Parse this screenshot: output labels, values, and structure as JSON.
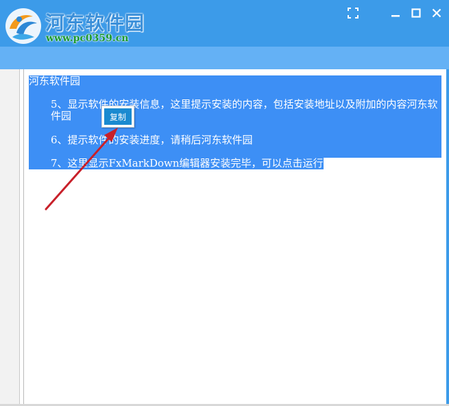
{
  "header": {
    "logo_title": "河东软件园",
    "logo_url": "www.pc0359.cn",
    "icons": [
      "logo-icon",
      "fullscreen-icon",
      "minimize-icon",
      "maximize-icon",
      "close-icon"
    ]
  },
  "content": {
    "title": "河东软件园",
    "line5": "5、显示软件的安装信息，这里提示安装的内容，包括安装地址以及附加的内容河东软件园",
    "line6": "6、提示软件的安装进度，请稍后河东软件园",
    "line7": "7、这里显示FxMarkDown编辑器安装完毕，可以点击运行"
  },
  "context_menu": {
    "copy_label": "复制"
  },
  "colors": {
    "titlebar": "#3c9be9",
    "subbar": "#64b1f5",
    "selection": "#3d8ff5",
    "menu_item": "#1a8ad0",
    "arrow": "#c8202a"
  }
}
